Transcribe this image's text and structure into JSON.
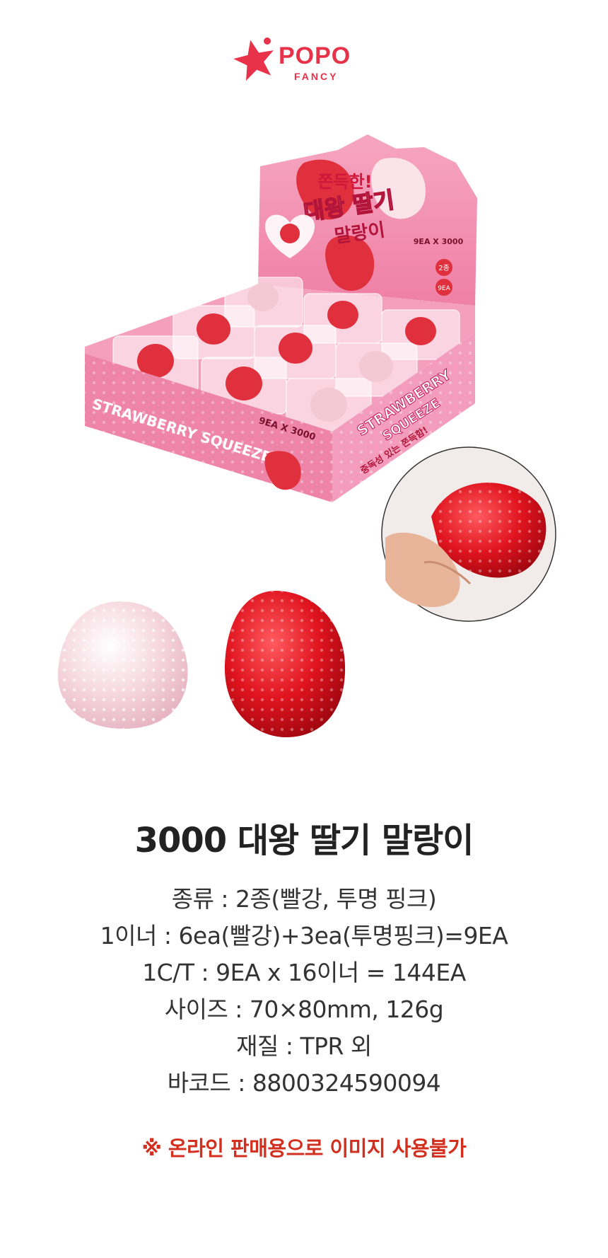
{
  "brand": {
    "name": "POPO",
    "sub": "FANCY",
    "color": "#e8324a"
  },
  "packaging": {
    "headline_1": "쫀득한!",
    "headline_2": "대왕 딸기",
    "headline_3": "말랑이",
    "count_label": "9EA X 3000",
    "side_label_1": "STRAWBERRY",
    "side_label_2": "SQUEEZE",
    "front_text": "STRAWBERRY SQUEEZE",
    "front_count": "9EA X 3000",
    "side_slogan": "중독성 있는 쫀득함!",
    "badge_1": "2종",
    "badge_2": "9EA"
  },
  "product": {
    "title": "3000 대왕 딸기 말랑이",
    "specs": [
      "종류 : 2종(빨강, 투명 핑크)",
      "1이너 : 6ea(빨강)+3ea(투명핑크)=9EA",
      "1C/T : 9EA x 16이너 = 144EA",
      "사이즈 : 70×80mm, 126g",
      "재질 : TPR 외",
      "바코드 : 8800324590094"
    ],
    "notice": "※ 온라인 판매용으로 이미지 사용불가",
    "notice_color": "#d32f1f"
  }
}
